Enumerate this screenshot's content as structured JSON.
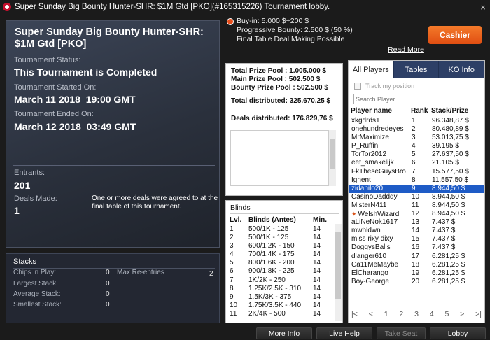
{
  "window": {
    "title": "Super Sunday Big Bounty Hunter-SHR: $1M Gtd [PKO](#165315226) Tournament lobby.",
    "close_glyph": "×"
  },
  "top_info": {
    "buyin": "Buy-in: 5.000 $+200 $",
    "bounty": "Progressive Bounty: 2.500 $ (50 %)",
    "deal": "Final Table Deal Making Possible",
    "read_more": "Read More",
    "cashier": "Cashier"
  },
  "tournament": {
    "name": "Super Sunday Big Bounty Hunter-SHR: $1M Gtd [PKO]",
    "status_label": "Tournament Status:",
    "status": "This Tournament is Completed",
    "started_label": "Tournament Started On:",
    "started": "March 11 2018  19:00 GMT",
    "ended_label": "Tournament Ended On:",
    "ended": "March 12 2018  03:49 GMT",
    "entrants_label": "Entrants:",
    "entrants": "201",
    "deals_label": "Deals Made:",
    "deals": "1",
    "deals_note": "One or more deals were agreed to at the final table of this tournament."
  },
  "stacks": {
    "title": "Stacks",
    "chips_label": "Chips in Play:",
    "chips": "0",
    "largest_label": "Largest Stack:",
    "largest": "0",
    "average_label": "Average Stack:",
    "average": "0",
    "smallest_label": "Smallest Stack:",
    "smallest": "0",
    "reentries_label": "Max Re-entries",
    "reentries": "2"
  },
  "prize": {
    "total": "Total Prize Pool : 1.005.000 $",
    "main": "Main Prize Pool : 502.500 $",
    "bounty": "Bounty Prize Pool : 502.500 $",
    "distributed": "Total distributed: 325.670,25 $",
    "deals_distributed": "Deals distributed: 176.829,76 $"
  },
  "blinds": {
    "title": "Blinds",
    "headers": [
      "Lvl.",
      "Blinds (Antes)",
      "Min."
    ],
    "rows": [
      [
        "1",
        "500/1K - 125",
        "14"
      ],
      [
        "2",
        "500/1K - 125",
        "14"
      ],
      [
        "3",
        "600/1.2K - 150",
        "14"
      ],
      [
        "4",
        "700/1.4K - 175",
        "14"
      ],
      [
        "5",
        "800/1.6K - 200",
        "14"
      ],
      [
        "6",
        "900/1.8K - 225",
        "14"
      ],
      [
        "7",
        "1K/2K - 250",
        "14"
      ],
      [
        "8",
        "1.25K/2.5K - 310",
        "14"
      ],
      [
        "9",
        "1.5K/3K - 375",
        "14"
      ],
      [
        "10",
        "1.75K/3.5K - 440",
        "14"
      ],
      [
        "11",
        "2K/4K - 500",
        "14"
      ]
    ]
  },
  "players": {
    "tabs": [
      "All Players",
      "Tables",
      "KO Info"
    ],
    "track_label": "Track my position",
    "search_placeholder": "Search Player",
    "headers": [
      "Player name",
      "Rank",
      "Stack/Prize"
    ],
    "rows": [
      [
        "xkgdrds1",
        "1",
        "96.348,87 $"
      ],
      [
        "onehundredeyes",
        "2",
        "80.480,89 $"
      ],
      [
        "MrMaximize",
        "3",
        "53.013,75 $"
      ],
      [
        "P_Ruffin",
        "4",
        "39.195 $"
      ],
      [
        "TorTor2012",
        "5",
        "27.637,50 $"
      ],
      [
        "eet_smakelijk",
        "6",
        "21.105 $"
      ],
      [
        "FkTheseGuysBro",
        "7",
        "15.577,50 $"
      ],
      [
        "Ignent",
        "8",
        "11.557,50 $"
      ],
      [
        "zidanilo20",
        "9",
        "8.944,50 $"
      ],
      [
        "CasinoDadddy",
        "10",
        "8.944,50 $"
      ],
      [
        "MisterN411",
        "11",
        "8.944,50 $"
      ],
      [
        "WelshWizard",
        "12",
        "8.944,50 $"
      ],
      [
        "aLiNeNok1617",
        "13",
        "7.437 $"
      ],
      [
        "mwhldwn",
        "14",
        "7.437 $"
      ],
      [
        "miss rixy dixy",
        "15",
        "7.437 $"
      ],
      [
        "DoggysBalls",
        "16",
        "7.437 $"
      ],
      [
        "dlanger610",
        "17",
        "6.281,25 $"
      ],
      [
        "Ca11MeMaybe",
        "18",
        "6.281,25 $"
      ],
      [
        "ElCharango",
        "19",
        "6.281,25 $"
      ],
      [
        "Boy-George",
        "20",
        "6.281,25 $"
      ]
    ],
    "selected_rank": "9",
    "ko_marker": "✦",
    "pager": [
      "|<",
      "<",
      "1",
      "2",
      "3",
      "4",
      "5",
      ">",
      ">|"
    ]
  },
  "bottom": {
    "more_info": "More Info",
    "live_help": "Live Help",
    "take_seat": "Take Seat",
    "lobby": "Lobby"
  }
}
